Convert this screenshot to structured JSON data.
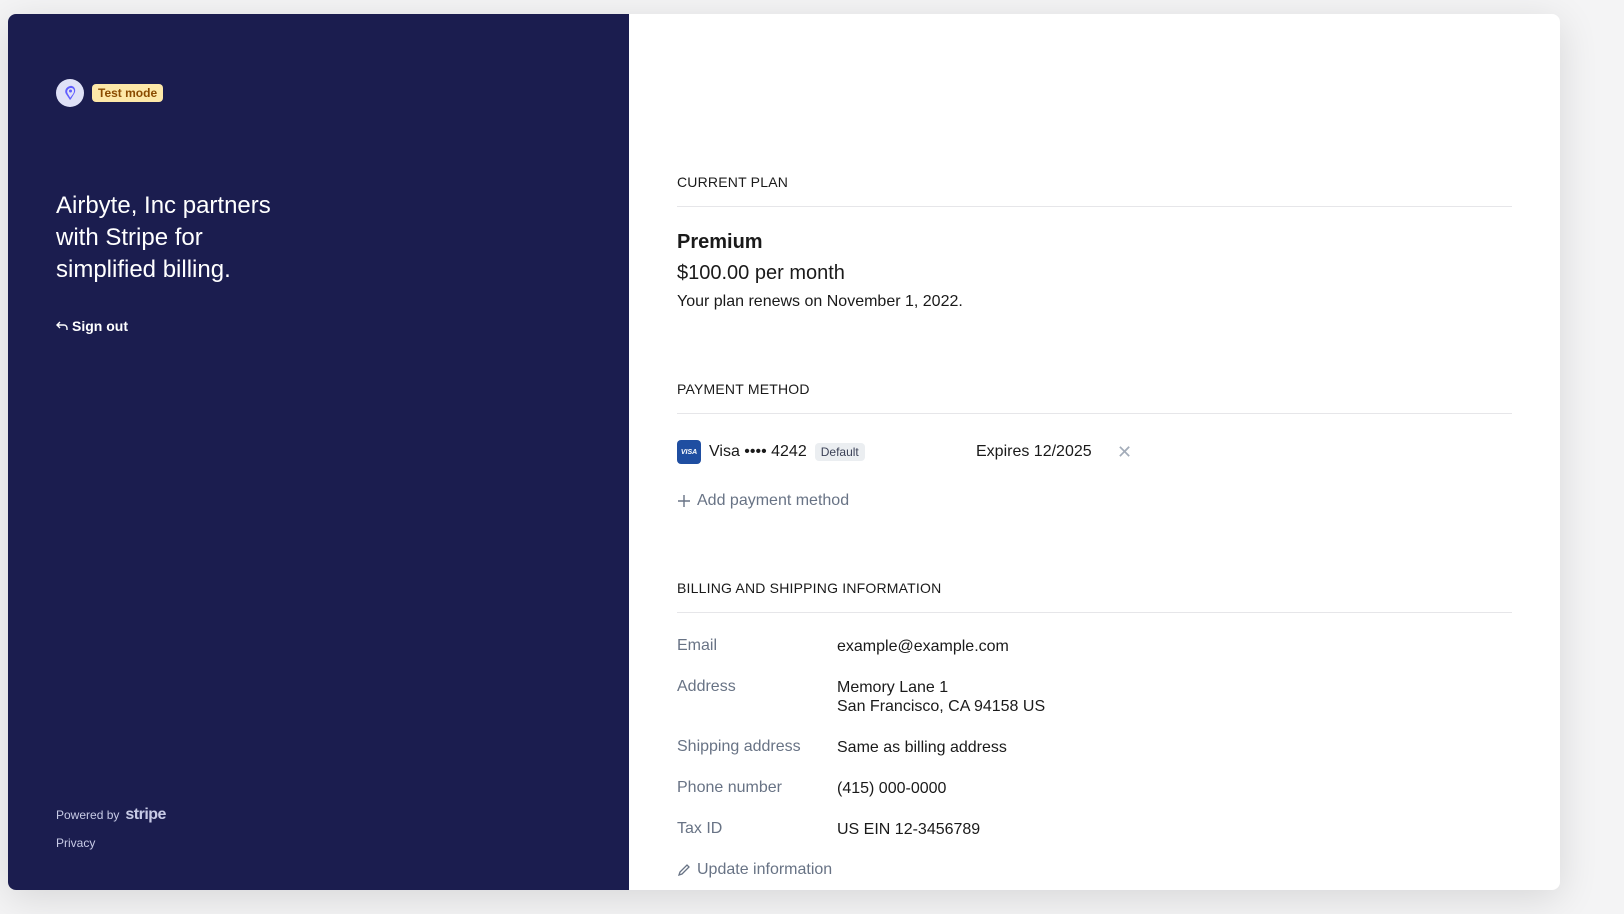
{
  "left": {
    "badge": "Test mode",
    "tagline": "Airbyte, Inc partners with Stripe for simplified billing.",
    "signout": "Sign out",
    "powered_by": "Powered by",
    "stripe": "stripe",
    "privacy": "Privacy",
    "bg": "#1b1d4f"
  },
  "plan": {
    "title": "CURRENT PLAN",
    "name": "Premium",
    "price": "$100.00 per month",
    "renew": "Your plan renews on November 1, 2022."
  },
  "payment": {
    "title": "PAYMENT METHOD",
    "card_brand_icon": "VISA",
    "card": "Visa •••• 4242",
    "default": "Default",
    "expires": "Expires 12/2025",
    "add": "Add payment method"
  },
  "billing": {
    "title": "BILLING AND SHIPPING INFORMATION",
    "email_label": "Email",
    "email_value": "example@example.com",
    "address_label": "Address",
    "address_line1": "Memory Lane 1",
    "address_line2": "San Francisco, CA 94158 US",
    "shipping_label": "Shipping address",
    "shipping_value": "Same as billing address",
    "phone_label": "Phone number",
    "phone_value": "(415) 000-0000",
    "tax_label": "Tax ID",
    "tax_value": "US EIN 12-3456789",
    "update": "Update information"
  }
}
